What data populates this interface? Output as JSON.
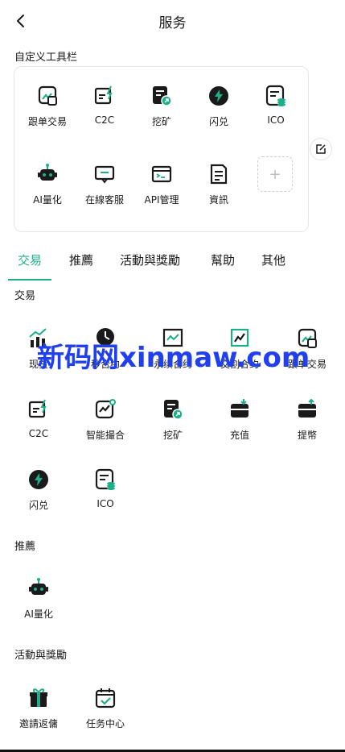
{
  "header": {
    "title": "服务"
  },
  "toolbar": {
    "title": "自定义工具栏",
    "items": [
      {
        "label": "跟单交易",
        "icon": "copy-trade-icon"
      },
      {
        "label": "C2C",
        "icon": "c2c-icon"
      },
      {
        "label": "挖矿",
        "icon": "mining-icon"
      },
      {
        "label": "闪兑",
        "icon": "flash-swap-icon"
      },
      {
        "label": "ICO",
        "icon": "ico-icon"
      },
      {
        "label": "AI量化",
        "icon": "robot-icon"
      },
      {
        "label": "在線客服",
        "icon": "support-icon"
      },
      {
        "label": "API管理",
        "icon": "api-icon"
      },
      {
        "label": "資訊",
        "icon": "news-icon"
      }
    ],
    "add_symbol": "+"
  },
  "tabs": [
    {
      "label": "交易",
      "active": true
    },
    {
      "label": "推薦",
      "active": false
    },
    {
      "label": "活動與獎勵",
      "active": false
    },
    {
      "label": "幫助",
      "active": false
    },
    {
      "label": "其他",
      "active": false
    }
  ],
  "sections": {
    "trade": {
      "title": "交易",
      "items": [
        {
          "label": "现货",
          "icon": "spot-icon"
        },
        {
          "label": "秒合约",
          "icon": "second-contract-icon"
        },
        {
          "label": "永续合约",
          "icon": "perpetual-icon"
        },
        {
          "label": "交割合约",
          "icon": "delivery-icon"
        },
        {
          "label": "跟单交易",
          "icon": "copy-trade-icon"
        },
        {
          "label": "C2C",
          "icon": "c2c-icon"
        },
        {
          "label": "智能撮合",
          "icon": "smart-match-icon"
        },
        {
          "label": "挖矿",
          "icon": "mining-icon"
        },
        {
          "label": "充值",
          "icon": "deposit-icon"
        },
        {
          "label": "提幣",
          "icon": "withdraw-icon"
        },
        {
          "label": "闪兑",
          "icon": "flash-swap-icon"
        },
        {
          "label": "ICO",
          "icon": "ico-icon"
        }
      ]
    },
    "recommend": {
      "title": "推薦",
      "items": [
        {
          "label": "AI量化",
          "icon": "robot-icon"
        }
      ]
    },
    "activity": {
      "title": "活動與獎勵",
      "items": [
        {
          "label": "邀請返傭",
          "icon": "gift-icon"
        },
        {
          "label": "任务中心",
          "icon": "task-center-icon"
        }
      ]
    }
  },
  "watermark": "新码网xinmaw.com",
  "colors": {
    "accent": "#1fae8a",
    "icon_dark": "#1a1a1a",
    "watermark": "#1f3ff0"
  }
}
